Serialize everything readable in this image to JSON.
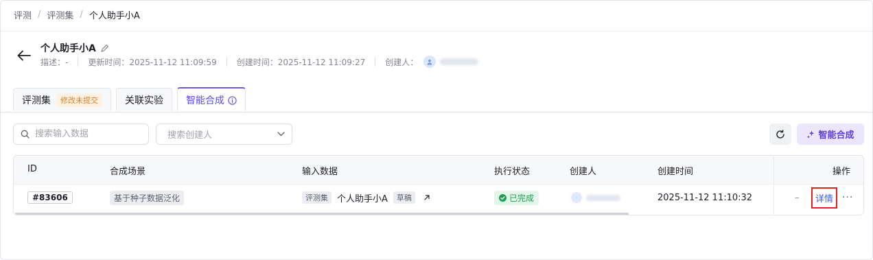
{
  "breadcrumb": [
    "评测",
    "评测集",
    "个人助手小A"
  ],
  "header": {
    "title": "个人助手小A",
    "description": "描述：-",
    "updated": "更新时间：2025-11-12 11:09:59",
    "created": "创建时间：2025-11-12 11:09:27",
    "creator_label": "创建人："
  },
  "tabs": [
    {
      "label": "评测集",
      "badge": "修改未提交"
    },
    {
      "label": "关联实验"
    },
    {
      "label": "智能合成",
      "active": true
    }
  ],
  "toolbar": {
    "search_placeholder": "搜索输入数据",
    "creator_placeholder": "搜索创建人",
    "generate_label": "智能合成"
  },
  "table": {
    "columns": [
      "ID",
      "合成场景",
      "输入数据",
      "执行状态",
      "创建人",
      "创建时间",
      "操作"
    ],
    "rows": [
      {
        "id": "#83606",
        "scene": "基于种子数据泛化",
        "input_type": "评测集",
        "input_name": "个人助手小A",
        "input_version": "草稿",
        "status": "已完成",
        "created_time": "2025-11-12 11:10:32",
        "dash": "–",
        "detail": "详情",
        "more": "···"
      }
    ]
  },
  "colors": {
    "accent": "#5e4be0",
    "link": "#3d5ee8",
    "success": "#1e9e50",
    "highlight_border": "#e0221b"
  }
}
